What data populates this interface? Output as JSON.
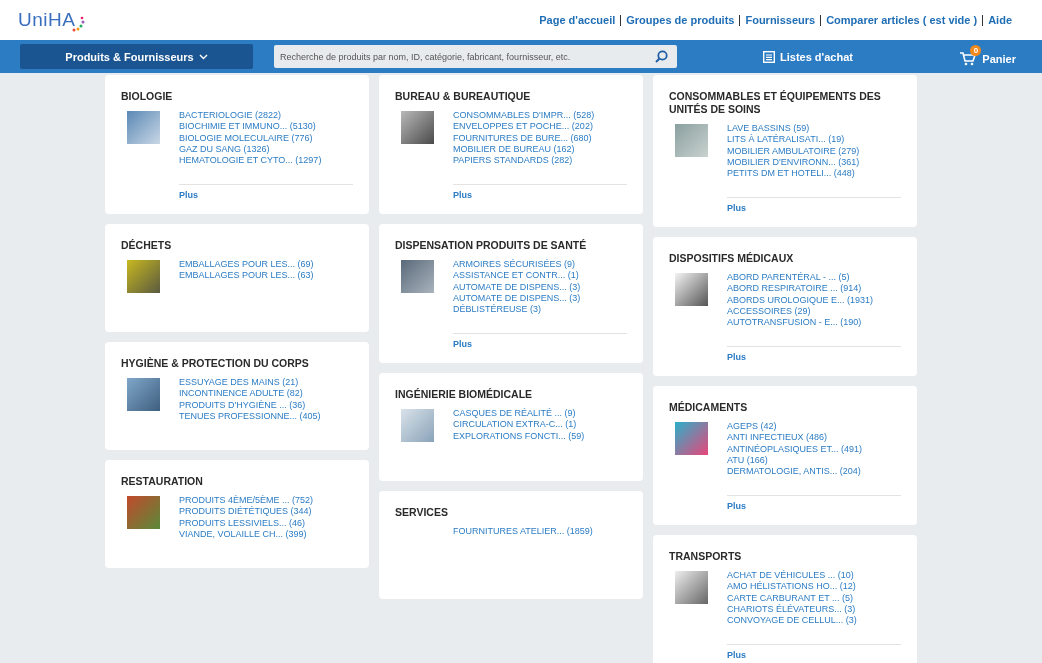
{
  "header": {
    "logo": "UniHA",
    "links": [
      "Page d'accueil",
      "Groupes de produits",
      "Fournisseurs",
      "Comparer articles ( est vide )",
      "Aide"
    ]
  },
  "nav": {
    "menu_button": "Produits & Fournisseurs",
    "search": {
      "placeholder": "Recherche de produits par nom, ID, catégorie, fabricant, fournisseur, etc."
    },
    "lists_link": "Listes d'achat",
    "cart": {
      "label": "Panier",
      "count": "0"
    }
  },
  "columns": [
    [
      {
        "title": "BIOLOGIE",
        "has_image": true,
        "items": [
          "BACTERIOLOGIE (2822)",
          "BIOCHIMIE ET IMMUNO... (5130)",
          "BIOLOGIE MOLECULAIRE (776)",
          "GAZ DU SANG (1326)",
          "HEMATOLOGIE ET CYTO... (1297)"
        ],
        "more": "Plus"
      },
      {
        "title": "DÉCHETS",
        "has_image": true,
        "items": [
          "EMBALLAGES POUR LES... (69)",
          "EMBALLAGES POUR LES... (63)"
        ]
      },
      {
        "title": "HYGIÈNE & PROTECTION DU CORPS",
        "has_image": true,
        "items": [
          "ESSUYAGE DES MAINS (21)",
          "INCONTINENCE ADULTE (82)",
          "PRODUITS D'HYGIÈNE ... (36)",
          "TENUES PROFESSIONNE... (405)"
        ]
      },
      {
        "title": "RESTAURATION",
        "has_image": true,
        "items": [
          "PRODUITS 4ÈME/5ÈME ... (752)",
          "PRODUITS DIÉTÉTIQUES (344)",
          "PRODUITS LESSIVIELS... (46)",
          "VIANDE, VOLAILLE CH... (399)"
        ]
      }
    ],
    [
      {
        "title": "BUREAU & BUREAUTIQUE",
        "has_image": true,
        "items": [
          "CONSOMMABLES D'IMPR... (528)",
          "ENVELOPPES ET POCHE... (202)",
          "FOURNITURES DE BURE... (680)",
          "MOBILIER DE BUREAU (162)",
          "PAPIERS STANDARDS (282)"
        ],
        "more": "Plus"
      },
      {
        "title": "DISPENSATION PRODUITS DE SANTÉ",
        "has_image": true,
        "items": [
          "ARMOIRES SÉCURISÉES (9)",
          "ASSISTANCE ET CONTR... (1)",
          "AUTOMATE DE DISPENS... (3)",
          "AUTOMATE DE DISPENS... (3)",
          "DÉBLISTÉREUSE (3)"
        ],
        "more": "Plus"
      },
      {
        "title": "INGÉNIERIE BIOMÉDICALE",
        "has_image": true,
        "items": [
          "CASQUES DE RÉALITÉ ... (9)",
          "CIRCULATION EXTRA-C... (1)",
          "EXPLORATIONS FONCTI... (59)"
        ]
      },
      {
        "title": "SERVICES",
        "has_image": false,
        "items": [
          "FOURNITURES ATELIER... (1859)"
        ]
      }
    ],
    [
      {
        "title": "CONSOMMABLES ET ÉQUIPEMENTS DES UNITÉS DE SOINS",
        "has_image": true,
        "items": [
          "LAVE BASSINS (59)",
          "LITS À LATÉRALISATI... (19)",
          "MOBILIER AMBULATOIRE (279)",
          "MOBILIER D'ENVIRONN... (361)",
          "PETITS DM ET HOTELI... (448)"
        ],
        "more": "Plus"
      },
      {
        "title": "DISPOSITIFS MÉDICAUX",
        "has_image": true,
        "items": [
          "ABORD PARENTÉRAL - ... (5)",
          "ABORD RESPIRATOIRE ... (914)",
          "ABORDS UROLOGIQUE E... (1931)",
          "ACCESSOIRES (29)",
          "AUTOTRANSFUSION - E... (190)"
        ],
        "more": "Plus"
      },
      {
        "title": "MÉDICAMENTS",
        "has_image": true,
        "items": [
          "AGEPS (42)",
          "ANTI INFECTIEUX (486)",
          "ANTINÉOPLASIQUES ET... (491)",
          "ATU (166)",
          "DERMATOLOGIE, ANTIS... (204)"
        ],
        "more": "Plus"
      },
      {
        "title": "TRANSPORTS",
        "has_image": true,
        "items": [
          "ACHAT DE VÉHICULES ... (10)",
          "AMO HÉLISTATIONS HO... (12)",
          "CARTE CARBURANT ET ... (5)",
          "CHARIOTS ÉLÉVATEURS... (3)",
          "CONVOYAGE DE CELLUL... (3)"
        ],
        "more": "Plus"
      }
    ]
  ]
}
